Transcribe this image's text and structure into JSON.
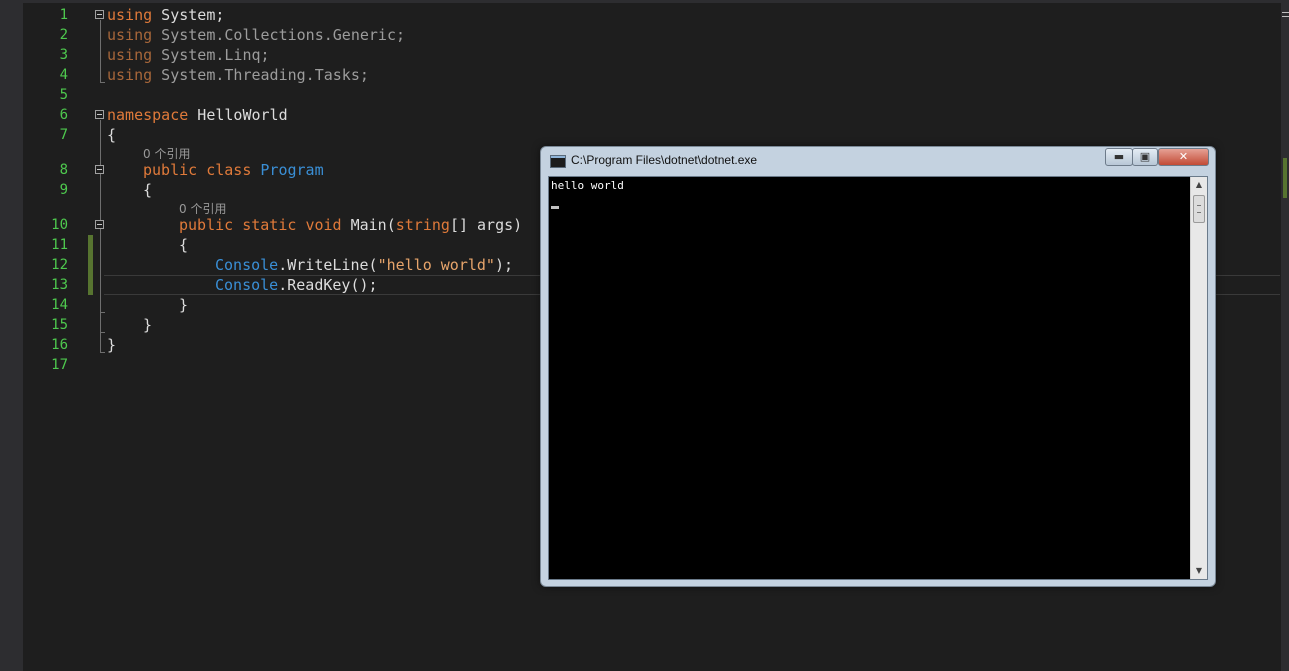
{
  "editor": {
    "line_numbers": [
      "1",
      "2",
      "3",
      "4",
      "5",
      "6",
      "7",
      "8",
      "9",
      "10",
      "11",
      "12",
      "13",
      "14",
      "15",
      "16",
      "17"
    ],
    "codelens_class": "0 个引用",
    "codelens_method": "0 个引用",
    "code": {
      "l1_kw": "using",
      "l1_rest": " System;",
      "l2_kw": "using",
      "l2_rest": " System.Collections.Generic;",
      "l3_kw": "using",
      "l3_rest": " System.Linq;",
      "l4_kw": "using",
      "l4_rest": " System.Threading.Tasks;",
      "l6_kw": "namespace",
      "l6_rest": " HelloWorld",
      "l7": "{",
      "l8_kw1": "public",
      "l8_kw2": "class",
      "l8_type": "Program",
      "l9": "{",
      "l10_kw1": "public",
      "l10_kw2": "static",
      "l10_kw3": "void",
      "l10_name": "Main(",
      "l10_kw4": "string",
      "l10_rest": "[] args)",
      "l11": "{",
      "l12_type": "Console",
      "l12_mid": ".WriteLine(",
      "l12_str": "\"hello world\"",
      "l12_end": ");",
      "l13_type": "Console",
      "l13_rest": ".ReadKey();",
      "l14": "}",
      "l15": "}",
      "l16": "}"
    }
  },
  "console": {
    "title": "C:\\Program Files\\dotnet\\dotnet.exe",
    "output": "hello world",
    "minimize_label": "▬",
    "maximize_label": "▣",
    "close_label": "✕",
    "scroll_up": "▲",
    "scroll_down": "▼"
  },
  "colors": {
    "editor_bg": "#1e1e1e",
    "keyword": "#e07a3a",
    "type": "#3a8fd6",
    "string": "#e8a56b",
    "line_number": "#4ec94e",
    "console_bg": "#000000"
  }
}
